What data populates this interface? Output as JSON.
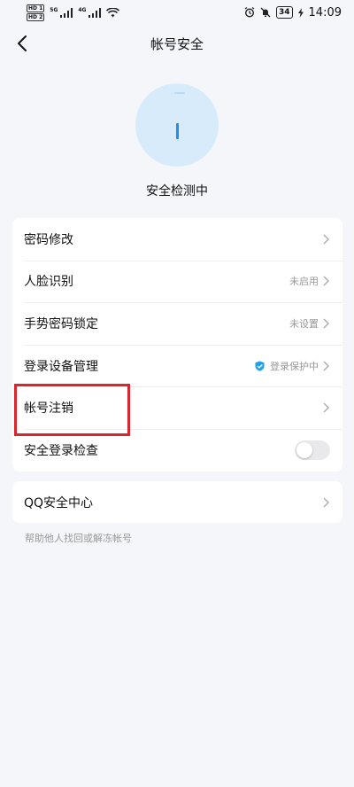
{
  "status_bar": {
    "hd1": "HD 1",
    "hd2": "HD 2",
    "net1": "5G",
    "net2": "4G",
    "battery": "34",
    "time": "14:09"
  },
  "nav": {
    "title": "帐号安全"
  },
  "security_check": {
    "label": "安全检测中"
  },
  "settings": {
    "items": [
      {
        "label": "密码修改",
        "value": ""
      },
      {
        "label": "人脸识别",
        "value": "未启用"
      },
      {
        "label": "手势密码锁定",
        "value": "未设置"
      },
      {
        "label": "登录设备管理",
        "value": "登录保护中"
      },
      {
        "label": "帐号注销",
        "value": ""
      },
      {
        "label": "安全登录检查",
        "value": ""
      }
    ],
    "toggle_on": false
  },
  "qq_security": {
    "label": "QQ安全中心",
    "footnote": "帮助他人找回或解冻帐号"
  },
  "colors": {
    "accent": "#1e8fe6",
    "highlight": "#d9262e",
    "background": "#f5f6fa"
  }
}
